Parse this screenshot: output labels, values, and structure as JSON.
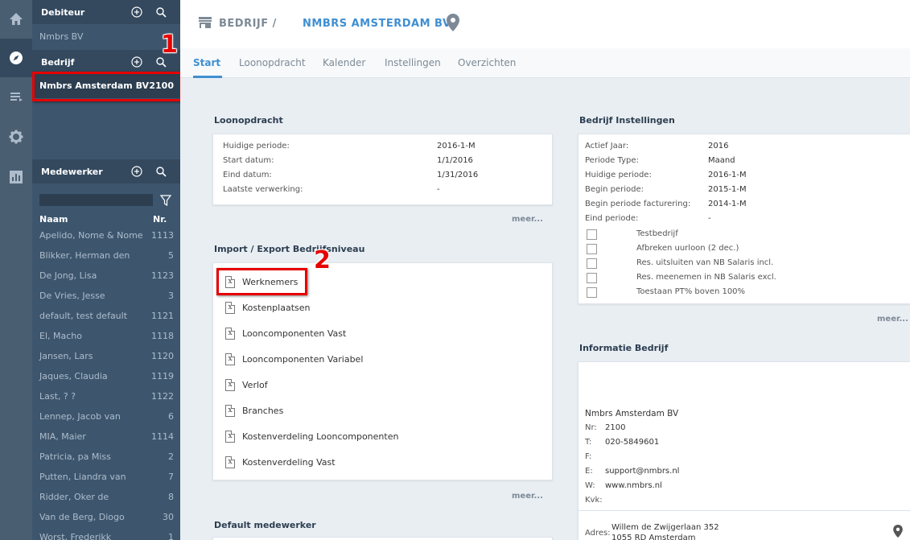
{
  "rail": {
    "icons": [
      "home-icon",
      "compass-icon",
      "list-icon",
      "gear-icon",
      "chart-icon"
    ]
  },
  "sidebar": {
    "debiteur": {
      "title": "Debiteur",
      "item": "Nmbrs BV"
    },
    "bedrijf": {
      "title": "Bedrijf",
      "selected_name": "Nmbrs Amsterdam BV",
      "selected_number": "2100"
    },
    "medewerker": {
      "title": "Medewerker",
      "col_name": "Naam",
      "col_number": "Nr.",
      "employees": [
        {
          "name": "Apelido, Nome & Nome",
          "nr": "1113"
        },
        {
          "name": "Blikker, Herman den",
          "nr": "5"
        },
        {
          "name": "De Jong, Lisa",
          "nr": "1123"
        },
        {
          "name": "De Vries, Jesse",
          "nr": "3"
        },
        {
          "name": "default, test default",
          "nr": "1121"
        },
        {
          "name": "El, Macho",
          "nr": "1118"
        },
        {
          "name": "Jansen, Lars",
          "nr": "1120"
        },
        {
          "name": "Jaques, Claudia",
          "nr": "1119"
        },
        {
          "name": "Last, ? ?",
          "nr": "1122"
        },
        {
          "name": "Lennep, Jacob van",
          "nr": "6"
        },
        {
          "name": "MIA, Maier",
          "nr": "1114"
        },
        {
          "name": "Patricia, pa Miss",
          "nr": "2"
        },
        {
          "name": "Putten, Liandra van",
          "nr": "7"
        },
        {
          "name": "Ridder, Oker de",
          "nr": "8"
        },
        {
          "name": "Van de Berg, Diogo",
          "nr": "30"
        },
        {
          "name": "Worst, Frederikk",
          "nr": "1"
        }
      ]
    }
  },
  "annotations": {
    "marker1": "1",
    "marker2": "2"
  },
  "header": {
    "breadcrumb": "BEDRIJF /",
    "company": "NMBRS AMSTERDAM BV",
    "tabs": [
      "Start",
      "Loonopdracht",
      "Kalender",
      "Instellingen",
      "Overzichten"
    ],
    "active_tab": "Start"
  },
  "loonopdracht": {
    "title": "Loonopdracht",
    "rows": [
      {
        "label": "Huidige periode:",
        "value": "2016-1-M"
      },
      {
        "label": "Start datum:",
        "value": "1/1/2016"
      },
      {
        "label": "Eind datum:",
        "value": "1/31/2016"
      },
      {
        "label": "Laatste verwerking:",
        "value": "-"
      }
    ],
    "more": "meer..."
  },
  "import_export": {
    "title": "Import / Export Bedrijfsniveau",
    "files": [
      "Werknemers",
      "Kostenplaatsen",
      "Looncomponenten Vast",
      "Looncomponenten Variabel",
      "Verlof",
      "Branches",
      "Kostenverdeling Looncomponenten",
      "Kostenverdeling Vast"
    ],
    "more": "meer..."
  },
  "default_medewerker": {
    "title": "Default medewerker"
  },
  "bedrijf_instellingen": {
    "title": "Bedrijf Instellingen",
    "rows": [
      {
        "label": "Actief Jaar:",
        "value": "2016"
      },
      {
        "label": "Periode Type:",
        "value": "Maand"
      },
      {
        "label": "Huidige periode:",
        "value": "2016-1-M"
      },
      {
        "label": "Begin periode:",
        "value": "2015-1-M"
      },
      {
        "label": "Begin periode facturering:",
        "value": "2014-1-M"
      },
      {
        "label": "Eind periode:",
        "value": "-"
      }
    ],
    "checkboxes": [
      {
        "label": "Testbedrijf",
        "checked": false
      },
      {
        "label": "Afbreken uurloon (2 dec.)",
        "checked": false
      },
      {
        "label": "Res. uitsluiten van NB Salaris incl.",
        "checked": false
      },
      {
        "label": "Res. meenemen in NB Salaris excl.",
        "checked": false
      },
      {
        "label": "Toestaan PT% boven 100%",
        "checked": false
      }
    ],
    "more": "meer..."
  },
  "informatie_bedrijf": {
    "title": "Informatie Bedrijf",
    "company": "Nmbrs Amsterdam BV",
    "rows": [
      {
        "label": "Nr:",
        "value": "2100"
      },
      {
        "label": "T:",
        "value": "020-5849601"
      },
      {
        "label": "F:",
        "value": ""
      },
      {
        "label": "E:",
        "value": "support@nmbrs.nl"
      },
      {
        "label": "W:",
        "value": "www.nmbrs.nl"
      },
      {
        "label": "Kvk:",
        "value": ""
      }
    ],
    "adres_label": "Adres:",
    "adres_line1": "Willem de Zwijgerlaan 352",
    "adres_line2": "1055 RD Amsterdam"
  },
  "colors": {
    "accent": "#3f8fd2",
    "annotation": "#e60000",
    "sidebar": "#3d566e"
  }
}
